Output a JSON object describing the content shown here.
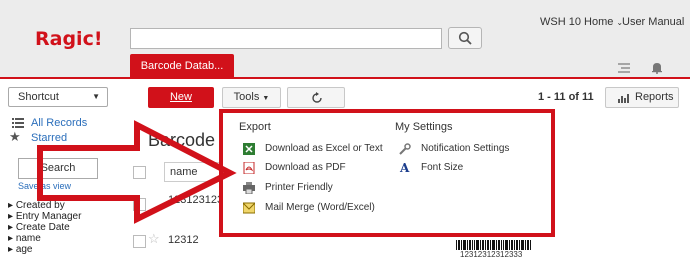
{
  "header": {
    "logo": "Ragic!",
    "search_placeholder": "",
    "menu_home": "WSH 10 Home",
    "menu_manual": "User Manual",
    "tab_label": "Barcode Datab..."
  },
  "toolbar": {
    "shortcut_label": "Shortcut",
    "new_label": "New",
    "tools_label": "Tools",
    "page_count": "1 - 11 of 11",
    "reports_label": "Reports"
  },
  "sidebar": {
    "all_records": "All Records",
    "starred": "Starred",
    "search_button": "Search",
    "save_view": "Save as view",
    "fields": [
      "Created by",
      "Entry Manager",
      "Create Date",
      "name",
      "age"
    ]
  },
  "main": {
    "title": "Barcode",
    "name_column": "name",
    "rows": [
      "1231231231",
      "12312"
    ],
    "barcode_text": "12312312312333"
  },
  "tools_menu": {
    "export_heading": "Export",
    "settings_heading": "My Settings",
    "export_items": [
      "Download as Excel or Text",
      "Download as PDF",
      "Printer Friendly",
      "Mail Merge (Word/Excel)"
    ],
    "settings_items": [
      "Notification Settings",
      "Font Size"
    ]
  },
  "colors": {
    "brand_red": "#d1111a",
    "link_blue": "#2a6ebb"
  },
  "icons": [
    "search-icon",
    "chevron-down-icon",
    "refresh-icon",
    "bar-chart-icon",
    "bell-icon",
    "star-icon",
    "excel-icon",
    "pdf-icon",
    "printer-icon",
    "mail-merge-icon",
    "wrench-icon",
    "font-icon"
  ]
}
